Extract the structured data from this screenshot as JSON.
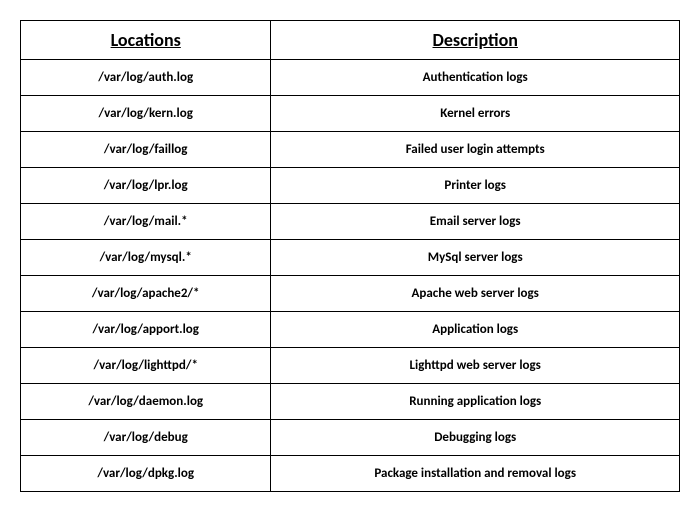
{
  "table": {
    "headers": {
      "col1": "Locations",
      "col2": "Description"
    },
    "rows": [
      {
        "location": "/var/log/auth.log",
        "description": "Authentication logs"
      },
      {
        "location": "/var/log/kern.log",
        "description": "Kernel errors"
      },
      {
        "location": "/var/log/faillog",
        "description": "Failed user login attempts"
      },
      {
        "location": "/var/log/lpr.log",
        "description": "Printer logs"
      },
      {
        "location": "/var/log/mail.*",
        "description": "Email server logs"
      },
      {
        "location": "/var/log/mysql.*",
        "description": "MySql server logs"
      },
      {
        "location": "/var/log/apache2/*",
        "description": "Apache web server logs"
      },
      {
        "location": "/var/log/apport.log",
        "description": "Application logs"
      },
      {
        "location": "/var/log/lighttpd/*",
        "description": "Lighttpd web server logs"
      },
      {
        "location": "/var/log/daemon.log",
        "description": "Running application logs"
      },
      {
        "location": "/var/log/debug",
        "description": "Debugging logs"
      },
      {
        "location": "/var/log/dpkg.log",
        "description": "Package installation and removal logs"
      }
    ]
  }
}
